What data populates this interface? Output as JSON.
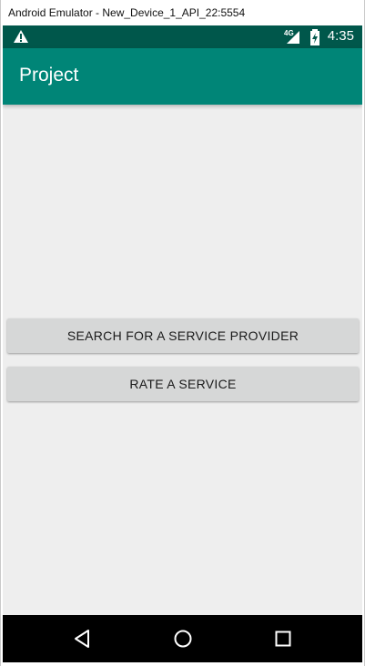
{
  "window": {
    "title": "Android Emulator - New_Device_1_API_22:5554"
  },
  "status_bar": {
    "left_icon": "warning-icon",
    "network_label": "4G",
    "signal_icon": "signal-icon",
    "battery_icon": "battery-charging-icon",
    "time": "4:35"
  },
  "app_bar": {
    "title": "Project"
  },
  "buttons": {
    "search_label": "SEARCH FOR A SERVICE PROVIDER",
    "rate_label": "RATE A SERVICE"
  },
  "nav_bar": {
    "back_icon": "back-icon",
    "home_icon": "home-icon",
    "recents_icon": "recents-icon"
  },
  "colors": {
    "status_bar": "#00574b",
    "app_bar": "#008577",
    "background": "#eeeeee",
    "button": "#d6d7d7"
  }
}
